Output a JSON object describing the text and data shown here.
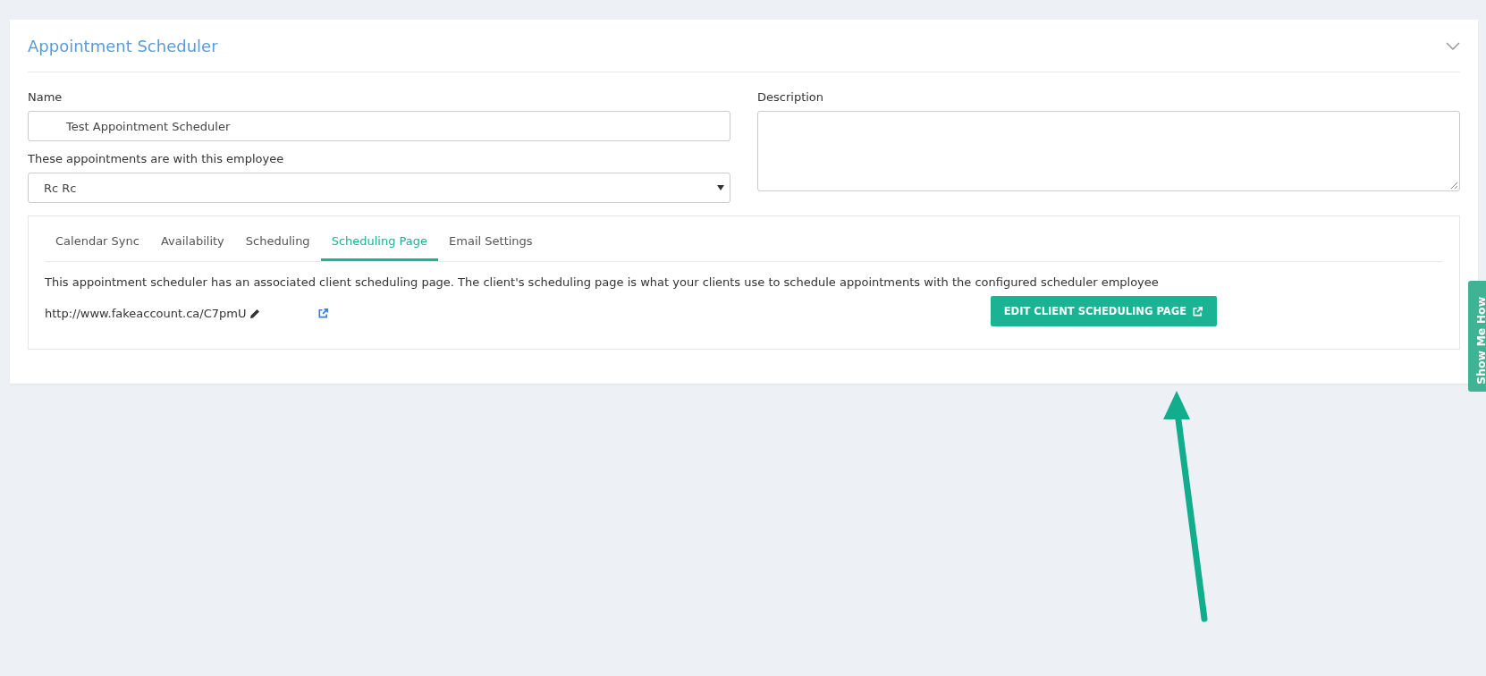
{
  "panel": {
    "title": "Appointment Scheduler",
    "expanded": true
  },
  "fields": [
    {
      "kind": "text",
      "label": "Name",
      "value": "Test Appointment Scheduler"
    },
    {
      "kind": "select",
      "label": "These appointments are with this employee",
      "value": "Rc Rc"
    },
    {
      "kind": "textarea",
      "label": "Description"
    }
  ],
  "tabs": [
    {
      "label": "Calendar Sync",
      "selected": false
    },
    {
      "label": "Availability",
      "selected": false
    },
    {
      "label": "Scheduling",
      "selected": false
    },
    {
      "label": "Scheduling Page",
      "selected": true
    },
    {
      "label": "Email Settings",
      "selected": false
    }
  ],
  "tab_content": {
    "description": "This appointment scheduler has an associated client scheduling page. The client's scheduling page is what your clients use to schedule appointments with the configured scheduler employee",
    "url": "http://www.fakeaccount.ca/C7pmU",
    "button": "EDIT CLIENT SCHEDULING PAGE"
  },
  "side_tab": "Show Me How"
}
